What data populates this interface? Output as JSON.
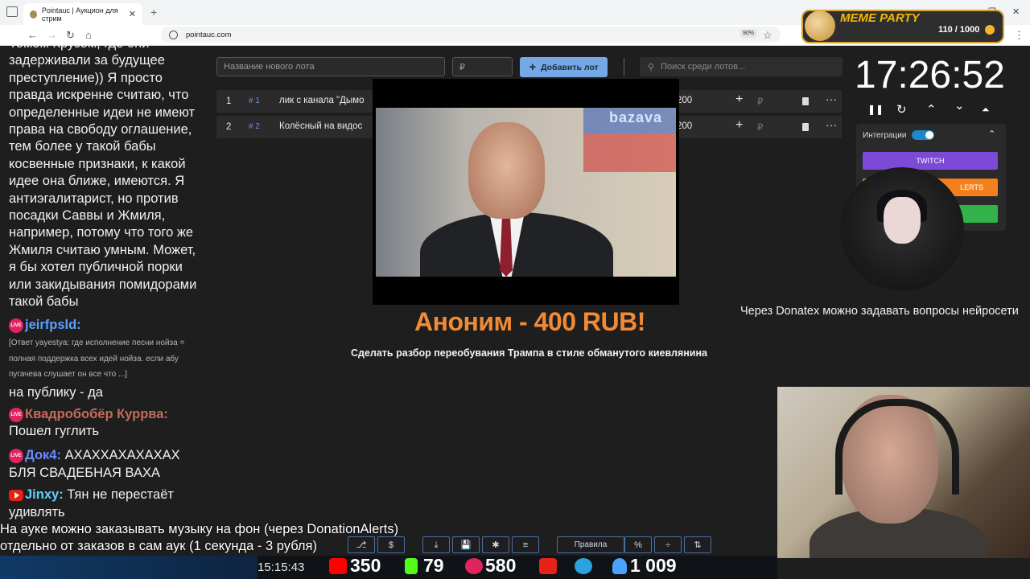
{
  "browser": {
    "tab_title": "Pointauc | Аукцион для стрим",
    "tab_close": "✕",
    "new_tab": "+",
    "url": "pointauc.com",
    "zoom": "90%",
    "controls": {
      "minimize": "—",
      "restore": "❐",
      "close": "✕",
      "more": "⋮",
      "back": "←",
      "forward": "→",
      "reload": "↻",
      "home": "⌂",
      "star": "☆"
    }
  },
  "meme_party": {
    "title": "MEME PARTY",
    "count": "110 / 1000"
  },
  "chat": {
    "long_message": "Томом Крузом, где они задерживали за будущее преступление)) Я просто правда искренне считаю, что определенные идеи не имеют права на свободу оглашение, тем более у такой бабы косвенные признаки, к какой идее она ближе, имеются. Я антиэгалитарист, но против посадки Саввы и Жмиля, например, потому что того же Жмиля считаю умным. Может, я бы хотел публичной порки или закидывания помидорами такой бабы",
    "messages": [
      {
        "platform": "live",
        "user": "jeirfpsld:",
        "user_color": "#5aa0ff",
        "quote": "[Ответ yayestya: где исполнение песни нойза = полная поддержка всех идей нойза. если абу пугачева слушает он все что ...]",
        "text": "на публику - да"
      },
      {
        "platform": "live",
        "user": "Квадробобёр Куррва:",
        "user_color": "#c66b5a",
        "text": "Пошел гуглить"
      },
      {
        "platform": "live",
        "user": "Док4:",
        "user_color": "#6b8cff",
        "text": "АХАХХАХАХАХАХ БЛЯ СВАДЕБНАЯ ВАХА"
      },
      {
        "platform": "youtube",
        "user": "Jinxy:",
        "user_color": "#5fd0ff",
        "text": "Тян не перестаёт удивлять"
      }
    ],
    "live_badge": "LIVE"
  },
  "auction": {
    "new_lot_placeholder": "Название нового лота",
    "amount_placeholder": "₽",
    "add_button": "Добавить лот",
    "search_placeholder": "Поиск среди лотов...",
    "lots": [
      {
        "index": "1",
        "id": "# 1",
        "name": "лик с канала \"Дымо",
        "amount": "200",
        "plus": "+",
        "rub": "₽",
        "more": "···"
      },
      {
        "index": "2",
        "id": "# 2",
        "name": "Колёсный на видос",
        "amount": "200",
        "plus": "+",
        "rub": "₽",
        "more": "···"
      }
    ]
  },
  "video": {
    "watermark": "bazava"
  },
  "donation": {
    "headline": "Аноним - 400 RUB!",
    "message": "Сделать разбор переобувания Трампа в стиле обманутого киевлянина"
  },
  "timer": {
    "time": "17:26:52",
    "icons": {
      "pause": "❚❚",
      "reset": "↻",
      "up": "⌃",
      "down": "⌄",
      "top": "⏶"
    }
  },
  "integrations": {
    "label": "Интеграции",
    "twitch": "TWITCH",
    "donationalerts": "LERTS",
    "collapse": "⌃"
  },
  "donatex_text": "Через Donatex можно задавать вопросы нейросети",
  "toolbar": {
    "rules": "Правила",
    "percent": "%",
    "github": "⎇",
    "dollar": "$",
    "download": "⤓",
    "save": "💾",
    "bug": "✱",
    "clear": "≡",
    "split": "÷",
    "sort": "⇅"
  },
  "subtitles": [
    "На ауке можно заказывать музыку на фон (через DonationAlerts)",
    "отдельно от заказов в сам аук (1 секунда - 3 рубля)"
  ],
  "stats": {
    "clock": "15:15:43",
    "youtube": "350",
    "kick": "79",
    "live": "580",
    "telegram_label": "",
    "viewers": "1 009",
    "colors": {
      "youtube": "#ff0000",
      "kick": "#53fc18",
      "live": "#e0245e",
      "telegram": "#2aa3df",
      "viewers": "#4aa3ff"
    }
  }
}
